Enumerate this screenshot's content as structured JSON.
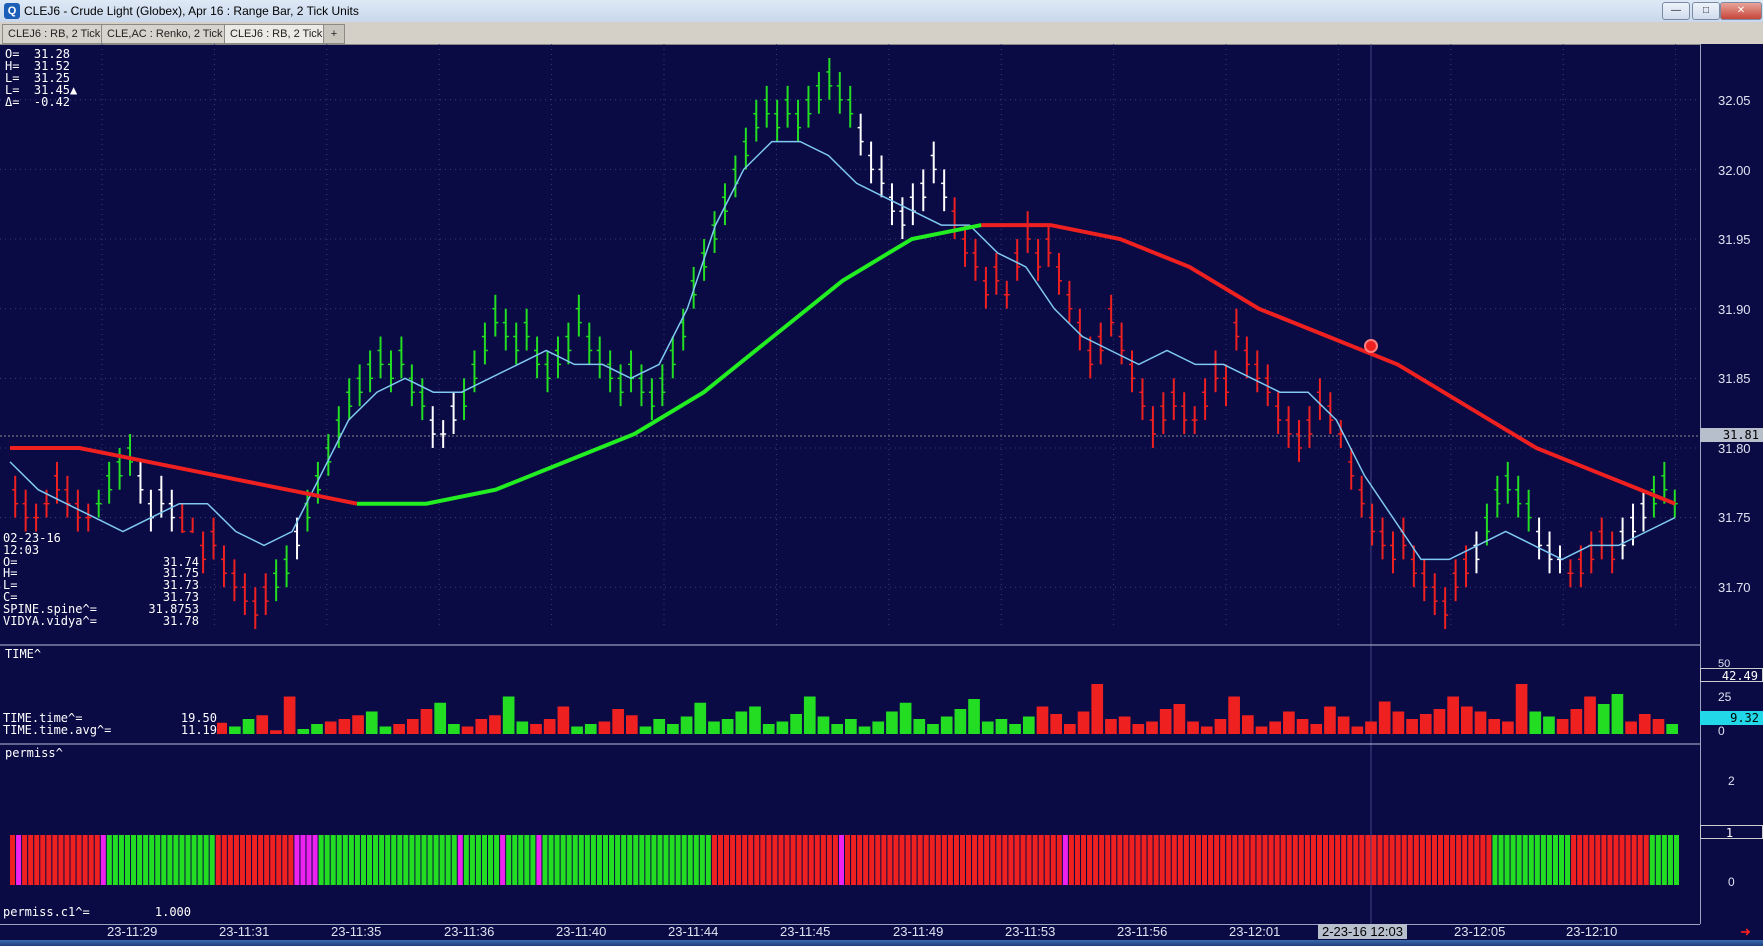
{
  "window": {
    "title": "CLEJ6 - Crude Light (Globex), Apr 16 : Range Bar, 2 Tick Units",
    "app_icon": "chart-app-icon",
    "min_label": "—",
    "max_label": "□",
    "close_label": "✕"
  },
  "tabs": [
    {
      "label": "CLEJ6 : RB, 2 Tick"
    },
    {
      "label": "CLE,AC : Renko, 2 Tick"
    },
    {
      "label": "CLEJ6 : RB, 2 Tick"
    },
    {
      "label": "+"
    }
  ],
  "ohlc_header": {
    "o": "O=  31.28",
    "h": "H=  31.52",
    "l": "L=  31.25",
    "l2": "L=  31.45▲",
    "d": "Δ=  -0.42"
  },
  "data_panel": {
    "date": "02-23-16",
    "time": "12:03",
    "rows": [
      {
        "k": "O=",
        "v": "31.74"
      },
      {
        "k": "H=",
        "v": "31.75"
      },
      {
        "k": "L=",
        "v": "31.73"
      },
      {
        "k": "C=",
        "v": "31.73"
      },
      {
        "k": "SPINE.spine^=",
        "v": "31.8753"
      },
      {
        "k": "VIDYA.vidya^=",
        "v": "31.78"
      }
    ]
  },
  "time_panel": {
    "label": "TIME^",
    "rows": [
      {
        "k": "TIME.time^=",
        "v": "19.50"
      },
      {
        "k": "TIME.time.avg^=",
        "v": "11.19"
      }
    ]
  },
  "permiss_panel": {
    "label": "permiss^",
    "rows": [
      {
        "k": "permiss.c1^=",
        "v": "1.000"
      }
    ]
  },
  "price_axis": {
    "labels": [
      "32.05",
      "32.00",
      "31.95",
      "31.90",
      "31.85",
      "31.80",
      "31.75",
      "31.70"
    ],
    "current": "31.81"
  },
  "time_axis_right": {
    "labels": [
      "50",
      "25",
      "0"
    ],
    "value_box": "42.49",
    "avg_box": "9.32"
  },
  "permiss_axis": {
    "labels": [
      "2",
      "1",
      "0"
    ]
  },
  "x_axis": {
    "labels": [
      "23-11:29",
      "23-11:31",
      "23-11:35",
      "23-11:36",
      "23-11:40",
      "23-11:44",
      "23-11:45",
      "23-11:49",
      "23-11:53",
      "23-11:56",
      "23-12:01",
      "23-12:05",
      "23-12:10"
    ],
    "cursor": "2-23-16  12:03"
  },
  "colors": {
    "background": "#0a0a45",
    "up": "#22dd22",
    "down": "#ee2020",
    "neutral": "#ffffff",
    "vidya": "#7fc8f0",
    "spine_up": "#22ee22",
    "spine_down": "#ee2020",
    "magenta": "#ee22ee"
  },
  "chart_data": {
    "type": "bar",
    "title": "",
    "ylim": [
      31.67,
      32.08
    ],
    "bars": [
      {
        "h": 31.78,
        "l": 31.75,
        "c": "d"
      },
      {
        "h": 31.77,
        "l": 31.74,
        "c": "d"
      },
      {
        "h": 31.76,
        "l": 31.74,
        "c": "d"
      },
      {
        "h": 31.77,
        "l": 31.75,
        "c": "d"
      },
      {
        "h": 31.79,
        "l": 31.76,
        "c": "d"
      },
      {
        "h": 31.78,
        "l": 31.75,
        "c": "d"
      },
      {
        "h": 31.77,
        "l": 31.74,
        "c": "d"
      },
      {
        "h": 31.76,
        "l": 31.74,
        "c": "d"
      },
      {
        "h": 31.77,
        "l": 31.75,
        "c": "u"
      },
      {
        "h": 31.79,
        "l": 31.76,
        "c": "u"
      },
      {
        "h": 31.8,
        "l": 31.77,
        "c": "u"
      },
      {
        "h": 31.81,
        "l": 31.78,
        "c": "u"
      },
      {
        "h": 31.79,
        "l": 31.76,
        "c": "n"
      },
      {
        "h": 31.77,
        "l": 31.74,
        "c": "n"
      },
      {
        "h": 31.78,
        "l": 31.75,
        "c": "n"
      },
      {
        "h": 31.77,
        "l": 31.74,
        "c": "n"
      },
      {
        "h": 31.76,
        "l": 31.73,
        "c": "d"
      },
      {
        "h": 31.75,
        "l": 31.72,
        "c": "d"
      },
      {
        "h": 31.74,
        "l": 31.71,
        "c": "d"
      },
      {
        "h": 31.75,
        "l": 31.72,
        "c": "d"
      },
      {
        "h": 31.73,
        "l": 31.7,
        "c": "d"
      },
      {
        "h": 31.72,
        "l": 31.69,
        "c": "d"
      },
      {
        "h": 31.71,
        "l": 31.68,
        "c": "d"
      },
      {
        "h": 31.7,
        "l": 31.67,
        "c": "d"
      },
      {
        "h": 31.71,
        "l": 31.68,
        "c": "d"
      },
      {
        "h": 31.72,
        "l": 31.69,
        "c": "u"
      },
      {
        "h": 31.73,
        "l": 31.7,
        "c": "u"
      },
      {
        "h": 31.75,
        "l": 31.72,
        "c": "n"
      },
      {
        "h": 31.77,
        "l": 31.74,
        "c": "u"
      },
      {
        "h": 31.79,
        "l": 31.76,
        "c": "u"
      },
      {
        "h": 31.81,
        "l": 31.78,
        "c": "u"
      },
      {
        "h": 31.83,
        "l": 31.8,
        "c": "u"
      },
      {
        "h": 31.85,
        "l": 31.82,
        "c": "u"
      },
      {
        "h": 31.86,
        "l": 31.83,
        "c": "u"
      },
      {
        "h": 31.87,
        "l": 31.84,
        "c": "u"
      },
      {
        "h": 31.88,
        "l": 31.85,
        "c": "u"
      },
      {
        "h": 31.87,
        "l": 31.84,
        "c": "u"
      },
      {
        "h": 31.88,
        "l": 31.85,
        "c": "u"
      },
      {
        "h": 31.86,
        "l": 31.83,
        "c": "u"
      },
      {
        "h": 31.85,
        "l": 31.82,
        "c": "u"
      },
      {
        "h": 31.83,
        "l": 31.8,
        "c": "n"
      },
      {
        "h": 31.82,
        "l": 31.8,
        "c": "n"
      },
      {
        "h": 31.84,
        "l": 31.81,
        "c": "n"
      },
      {
        "h": 31.85,
        "l": 31.82,
        "c": "u"
      },
      {
        "h": 31.87,
        "l": 31.84,
        "c": "u"
      },
      {
        "h": 31.89,
        "l": 31.86,
        "c": "u"
      },
      {
        "h": 31.91,
        "l": 31.88,
        "c": "u"
      },
      {
        "h": 31.9,
        "l": 31.87,
        "c": "u"
      },
      {
        "h": 31.89,
        "l": 31.86,
        "c": "u"
      },
      {
        "h": 31.9,
        "l": 31.87,
        "c": "u"
      },
      {
        "h": 31.88,
        "l": 31.85,
        "c": "u"
      },
      {
        "h": 31.87,
        "l": 31.84,
        "c": "u"
      },
      {
        "h": 31.88,
        "l": 31.85,
        "c": "u"
      },
      {
        "h": 31.89,
        "l": 31.86,
        "c": "u"
      },
      {
        "h": 31.91,
        "l": 31.88,
        "c": "u"
      },
      {
        "h": 31.89,
        "l": 31.86,
        "c": "u"
      },
      {
        "h": 31.88,
        "l": 31.85,
        "c": "u"
      },
      {
        "h": 31.87,
        "l": 31.84,
        "c": "u"
      },
      {
        "h": 31.86,
        "l": 31.83,
        "c": "u"
      },
      {
        "h": 31.87,
        "l": 31.84,
        "c": "u"
      },
      {
        "h": 31.86,
        "l": 31.83,
        "c": "u"
      },
      {
        "h": 31.85,
        "l": 31.82,
        "c": "u"
      },
      {
        "h": 31.86,
        "l": 31.83,
        "c": "u"
      },
      {
        "h": 31.88,
        "l": 31.85,
        "c": "u"
      },
      {
        "h": 31.9,
        "l": 31.87,
        "c": "u"
      },
      {
        "h": 31.93,
        "l": 31.9,
        "c": "u"
      },
      {
        "h": 31.95,
        "l": 31.92,
        "c": "u"
      },
      {
        "h": 31.97,
        "l": 31.94,
        "c": "u"
      },
      {
        "h": 31.99,
        "l": 31.96,
        "c": "u"
      },
      {
        "h": 32.01,
        "l": 31.98,
        "c": "u"
      },
      {
        "h": 32.03,
        "l": 32.0,
        "c": "u"
      },
      {
        "h": 32.05,
        "l": 32.02,
        "c": "u"
      },
      {
        "h": 32.06,
        "l": 32.03,
        "c": "u"
      },
      {
        "h": 32.05,
        "l": 32.02,
        "c": "u"
      },
      {
        "h": 32.06,
        "l": 32.03,
        "c": "u"
      },
      {
        "h": 32.05,
        "l": 32.02,
        "c": "u"
      },
      {
        "h": 32.06,
        "l": 32.03,
        "c": "u"
      },
      {
        "h": 32.07,
        "l": 32.04,
        "c": "u"
      },
      {
        "h": 32.08,
        "l": 32.05,
        "c": "u"
      },
      {
        "h": 32.07,
        "l": 32.04,
        "c": "u"
      },
      {
        "h": 32.06,
        "l": 32.03,
        "c": "u"
      },
      {
        "h": 32.04,
        "l": 32.01,
        "c": "n"
      },
      {
        "h": 32.02,
        "l": 31.99,
        "c": "n"
      },
      {
        "h": 32.01,
        "l": 31.98,
        "c": "n"
      },
      {
        "h": 31.99,
        "l": 31.96,
        "c": "n"
      },
      {
        "h": 31.98,
        "l": 31.95,
        "c": "n"
      },
      {
        "h": 31.99,
        "l": 31.96,
        "c": "n"
      },
      {
        "h": 32.0,
        "l": 31.97,
        "c": "n"
      },
      {
        "h": 32.02,
        "l": 31.99,
        "c": "n"
      },
      {
        "h": 32.0,
        "l": 31.97,
        "c": "n"
      },
      {
        "h": 31.98,
        "l": 31.95,
        "c": "d"
      },
      {
        "h": 31.96,
        "l": 31.93,
        "c": "d"
      },
      {
        "h": 31.95,
        "l": 31.92,
        "c": "d"
      },
      {
        "h": 31.93,
        "l": 31.9,
        "c": "d"
      },
      {
        "h": 31.94,
        "l": 31.91,
        "c": "d"
      },
      {
        "h": 31.92,
        "l": 31.9,
        "c": "d"
      },
      {
        "h": 31.95,
        "l": 31.92,
        "c": "d"
      },
      {
        "h": 31.97,
        "l": 31.94,
        "c": "d"
      },
      {
        "h": 31.95,
        "l": 31.92,
        "c": "d"
      },
      {
        "h": 31.96,
        "l": 31.93,
        "c": "d"
      },
      {
        "h": 31.94,
        "l": 31.91,
        "c": "d"
      },
      {
        "h": 31.92,
        "l": 31.89,
        "c": "d"
      },
      {
        "h": 31.9,
        "l": 31.87,
        "c": "d"
      },
      {
        "h": 31.88,
        "l": 31.85,
        "c": "d"
      },
      {
        "h": 31.89,
        "l": 31.86,
        "c": "d"
      },
      {
        "h": 31.91,
        "l": 31.88,
        "c": "d"
      },
      {
        "h": 31.89,
        "l": 31.86,
        "c": "d"
      },
      {
        "h": 31.87,
        "l": 31.84,
        "c": "d"
      },
      {
        "h": 31.85,
        "l": 31.82,
        "c": "d"
      },
      {
        "h": 31.83,
        "l": 31.8,
        "c": "d"
      },
      {
        "h": 31.84,
        "l": 31.81,
        "c": "d"
      },
      {
        "h": 31.85,
        "l": 31.82,
        "c": "d"
      },
      {
        "h": 31.84,
        "l": 31.81,
        "c": "d"
      },
      {
        "h": 31.83,
        "l": 31.81,
        "c": "d"
      },
      {
        "h": 31.85,
        "l": 31.82,
        "c": "d"
      },
      {
        "h": 31.87,
        "l": 31.84,
        "c": "d"
      },
      {
        "h": 31.86,
        "l": 31.83,
        "c": "d"
      },
      {
        "h": 31.9,
        "l": 31.87,
        "c": "d"
      },
      {
        "h": 31.88,
        "l": 31.85,
        "c": "d"
      },
      {
        "h": 31.87,
        "l": 31.84,
        "c": "d"
      },
      {
        "h": 31.86,
        "l": 31.83,
        "c": "d"
      },
      {
        "h": 31.84,
        "l": 31.81,
        "c": "d"
      },
      {
        "h": 31.83,
        "l": 31.8,
        "c": "d"
      },
      {
        "h": 31.82,
        "l": 31.79,
        "c": "d"
      },
      {
        "h": 31.83,
        "l": 31.8,
        "c": "d"
      },
      {
        "h": 31.85,
        "l": 31.82,
        "c": "d"
      },
      {
        "h": 31.84,
        "l": 31.81,
        "c": "d"
      },
      {
        "h": 31.82,
        "l": 31.8,
        "c": "d"
      },
      {
        "h": 31.8,
        "l": 31.77,
        "c": "d"
      },
      {
        "h": 31.78,
        "l": 31.75,
        "c": "d"
      },
      {
        "h": 31.76,
        "l": 31.73,
        "c": "d"
      },
      {
        "h": 31.75,
        "l": 31.72,
        "c": "d"
      },
      {
        "h": 31.74,
        "l": 31.71,
        "c": "d"
      },
      {
        "h": 31.75,
        "l": 31.72,
        "c": "d"
      },
      {
        "h": 31.73,
        "l": 31.7,
        "c": "d"
      },
      {
        "h": 31.72,
        "l": 31.69,
        "c": "d"
      },
      {
        "h": 31.71,
        "l": 31.68,
        "c": "d"
      },
      {
        "h": 31.7,
        "l": 31.67,
        "c": "d"
      },
      {
        "h": 31.72,
        "l": 31.69,
        "c": "d"
      },
      {
        "h": 31.73,
        "l": 31.7,
        "c": "d"
      },
      {
        "h": 31.74,
        "l": 31.71,
        "c": "n"
      },
      {
        "h": 31.76,
        "l": 31.73,
        "c": "u"
      },
      {
        "h": 31.78,
        "l": 31.75,
        "c": "u"
      },
      {
        "h": 31.79,
        "l": 31.76,
        "c": "u"
      },
      {
        "h": 31.78,
        "l": 31.75,
        "c": "u"
      },
      {
        "h": 31.77,
        "l": 31.74,
        "c": "u"
      },
      {
        "h": 31.75,
        "l": 31.72,
        "c": "n"
      },
      {
        "h": 31.74,
        "l": 31.71,
        "c": "n"
      },
      {
        "h": 31.73,
        "l": 31.71,
        "c": "n"
      },
      {
        "h": 31.72,
        "l": 31.7,
        "c": "d"
      },
      {
        "h": 31.73,
        "l": 31.7,
        "c": "d"
      },
      {
        "h": 31.74,
        "l": 31.71,
        "c": "d"
      },
      {
        "h": 31.75,
        "l": 31.72,
        "c": "d"
      },
      {
        "h": 31.74,
        "l": 31.71,
        "c": "d"
      },
      {
        "h": 31.75,
        "l": 31.72,
        "c": "n"
      },
      {
        "h": 31.76,
        "l": 31.73,
        "c": "n"
      },
      {
        "h": 31.77,
        "l": 31.74,
        "c": "n"
      },
      {
        "h": 31.78,
        "l": 31.75,
        "c": "u"
      },
      {
        "h": 31.79,
        "l": 31.76,
        "c": "u"
      },
      {
        "h": 31.77,
        "l": 31.75,
        "c": "u"
      }
    ],
    "vidya": [
      31.79,
      31.77,
      31.76,
      31.75,
      31.74,
      31.75,
      31.76,
      31.76,
      31.74,
      31.73,
      31.74,
      31.78,
      31.82,
      31.84,
      31.85,
      31.84,
      31.84,
      31.85,
      31.86,
      31.87,
      31.86,
      31.86,
      31.85,
      31.86,
      31.9,
      31.96,
      32.0,
      32.02,
      32.02,
      32.01,
      31.99,
      31.98,
      31.97,
      31.96,
      31.96,
      31.94,
      31.93,
      31.9,
      31.88,
      31.87,
      31.86,
      31.87,
      31.86,
      31.86,
      31.85,
      31.84,
      31.84,
      31.82,
      31.78,
      31.75,
      31.72,
      31.72,
      31.73,
      31.74,
      31.73,
      31.72,
      31.73,
      31.73,
      31.74,
      31.75
    ],
    "spine": [
      31.8,
      31.8,
      31.79,
      31.78,
      31.77,
      31.76,
      31.76,
      31.77,
      31.79,
      31.81,
      31.84,
      31.88,
      31.92,
      31.95,
      31.96,
      31.96,
      31.95,
      31.93,
      31.9,
      31.88,
      31.86,
      31.83,
      31.8,
      31.78,
      31.76
    ],
    "time_values": [
      6,
      4,
      2,
      12,
      14,
      2,
      5,
      3,
      4,
      3,
      8,
      6,
      5,
      7,
      8,
      9,
      6,
      12,
      15,
      3,
      30,
      4,
      8,
      10,
      12,
      15,
      18,
      6,
      8,
      12,
      20,
      25,
      8,
      6,
      12,
      15,
      30,
      10,
      8,
      12,
      22,
      6,
      8,
      10,
      20,
      15,
      6,
      12,
      8,
      14,
      25,
      10,
      12,
      18,
      22,
      8,
      10,
      16,
      30,
      14,
      8,
      12,
      6,
      10,
      18,
      25,
      12,
      8,
      14,
      20,
      28,
      10,
      12,
      8,
      14,
      22,
      16,
      8,
      18,
      40,
      12,
      14,
      8,
      10,
      20,
      24,
      10,
      6,
      12,
      30,
      15,
      6,
      10,
      18,
      12,
      8,
      22,
      14,
      6,
      10,
      26,
      18,
      12,
      16,
      20,
      30,
      22,
      18,
      12,
      10,
      40,
      18,
      14,
      12,
      20,
      30,
      24,
      32,
      10,
      16,
      12,
      8
    ],
    "permiss": [
      0,
      2,
      0,
      0,
      0,
      0,
      0,
      0,
      0,
      0,
      0,
      0,
      0,
      0,
      0,
      2,
      1,
      1,
      1,
      1,
      1,
      1,
      1,
      1,
      1,
      1,
      1,
      1,
      1,
      1,
      1,
      1,
      1,
      1,
      0,
      0,
      0,
      0,
      0,
      0,
      0,
      0,
      0,
      0,
      0,
      0,
      0,
      2,
      2,
      2,
      2,
      1,
      1,
      1,
      1,
      1,
      1,
      1,
      1,
      1,
      1,
      1,
      1,
      1,
      1,
      1,
      1,
      1,
      1,
      1,
      1,
      1,
      1,
      1,
      2,
      1,
      1,
      1,
      1,
      1,
      1,
      2,
      1,
      1,
      1,
      1,
      1,
      2,
      1,
      1,
      1,
      1,
      1,
      1,
      1,
      1,
      1,
      1,
      1,
      1,
      1,
      1,
      1,
      1,
      1,
      1,
      1,
      1,
      1,
      1,
      1,
      1,
      1,
      1,
      1,
      1,
      0,
      0,
      0,
      0,
      0,
      0,
      0,
      0,
      0,
      0,
      0,
      0,
      0,
      0,
      0,
      0,
      0,
      0,
      0,
      0,
      0,
      2,
      0,
      0,
      0,
      0,
      0,
      0,
      0,
      0,
      0,
      0,
      0,
      0,
      0,
      0,
      0,
      0,
      0,
      0,
      0,
      0,
      0,
      0,
      0,
      0,
      0,
      0,
      0,
      0,
      0,
      0,
      0,
      0,
      0,
      0,
      0,
      0,
      2,
      0,
      0,
      0,
      0,
      0,
      0,
      0,
      0,
      0,
      0,
      0,
      0,
      0,
      0,
      0,
      0,
      0,
      0,
      0,
      0,
      0,
      0,
      0,
      0,
      0,
      0,
      0,
      0,
      0,
      0,
      0,
      0,
      0,
      0,
      0,
      0,
      0,
      0,
      0,
      0,
      0,
      0,
      0,
      0,
      0,
      0,
      0,
      0,
      0,
      0,
      0,
      0,
      0,
      0,
      0,
      0,
      0,
      0,
      0,
      0,
      0,
      0,
      0,
      0,
      0,
      0,
      0,
      0,
      0,
      0,
      1,
      1,
      1,
      1,
      1,
      1,
      1,
      1,
      1,
      1,
      1,
      1,
      1,
      0,
      0,
      0,
      0,
      0,
      0,
      0,
      0,
      0,
      0,
      0,
      0,
      0,
      1,
      1,
      1,
      1,
      1
    ]
  }
}
